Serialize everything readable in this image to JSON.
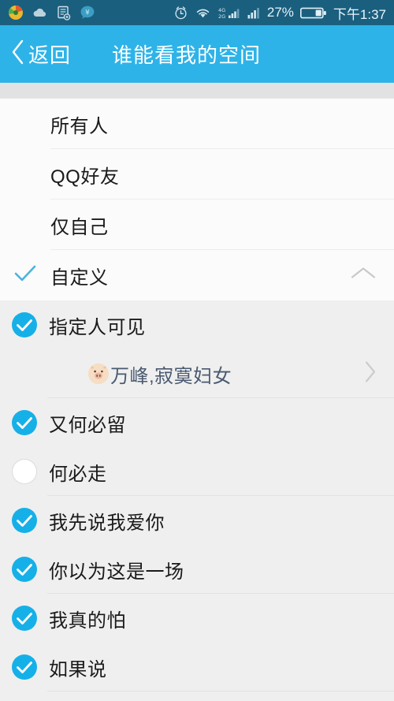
{
  "statusbar": {
    "left_icons": [
      "app-colorful-icon",
      "cloud-icon",
      "document-sync-icon",
      "qq-wallet-icon"
    ],
    "alarm_icon": "alarm-clock-icon",
    "wifi_icon": "wifi-icon",
    "signal1_icon": "signal-4g-2g-dual-icon",
    "signal1_label_top": "4G",
    "signal1_label_bottom": "2G",
    "signal2_icon": "signal-bars-icon",
    "battery_percent": "27%",
    "battery_icon": "battery-icon",
    "time": "下午1:37"
  },
  "header": {
    "back_icon": "chevron-left-icon",
    "back_label": "返回",
    "title": "谁能看我的空间"
  },
  "options": [
    {
      "label": "所有人",
      "selected": false,
      "expandable": false
    },
    {
      "label": "QQ好友",
      "selected": false,
      "expandable": false
    },
    {
      "label": "仅自己",
      "selected": false,
      "expandable": false
    },
    {
      "label": "自定义",
      "selected": true,
      "expandable": true,
      "check_icon": "check-icon",
      "chevron_icon": "chevron-up-icon"
    }
  ],
  "custom_section": {
    "header_row": {
      "label": "指定人可见",
      "checked": true,
      "icon": "checkbox-checked-icon"
    },
    "selected_people": {
      "avatar_icon": "pig-face-avatar-icon",
      "avatar_glyph": "🐽",
      "names": "万峰,寂寞妇女",
      "chevron_icon": "chevron-right-icon"
    },
    "friends": [
      {
        "label": "又何必留",
        "checked": true
      },
      {
        "label": "何必走",
        "checked": false
      },
      {
        "label": "我先说我爱你",
        "checked": true
      },
      {
        "label": "你以为这是一场",
        "checked": true
      },
      {
        "label": "我真的怕",
        "checked": true
      },
      {
        "label": "如果说",
        "checked": true
      }
    ]
  },
  "colors": {
    "statusbar_bg": "#1b5f7e",
    "header_bg": "#2eb3e8",
    "accent": "#29b0e8",
    "white_list_bg": "#fbfbfb",
    "gray_list_bg": "#efefef",
    "sub_text": "#4a5a70"
  }
}
